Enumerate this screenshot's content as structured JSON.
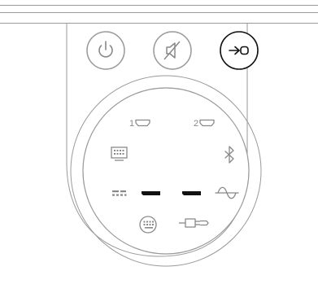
{
  "remote": {
    "buttons": [
      {
        "name": "power-button",
        "icon": "power-icon",
        "active": false
      },
      {
        "name": "mute-button",
        "icon": "mute-icon",
        "active": false
      },
      {
        "name": "source-button",
        "icon": "source-input-icon",
        "active": true
      }
    ],
    "input_labels": {
      "hdmi_1": "1",
      "hdmi_2": "2"
    },
    "input_icons": [
      "hdmi-1-icon",
      "hdmi-2-icon",
      "tv-icon",
      "bluetooth-icon",
      "digital-optical-icon",
      "analog-icon",
      "usb-icon",
      "aux-3.5mm-icon",
      "led-indicator"
    ]
  },
  "colors": {
    "outline": "#9a9a9a",
    "icon": "#888888",
    "active": "#111111",
    "led": "#111111"
  }
}
